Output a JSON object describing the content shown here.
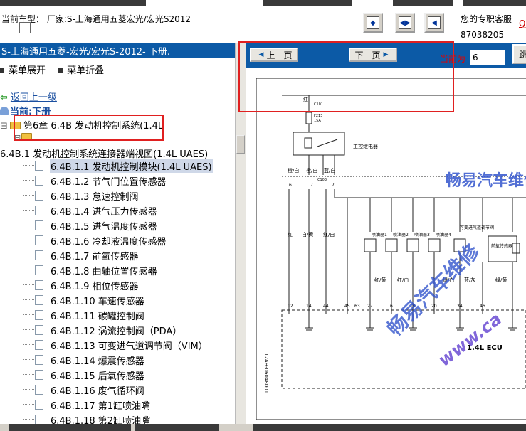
{
  "header": {
    "vehicle_label": "当前车型： 厂家:S-上海通用五菱宏光/宏光S2012",
    "service_label": "您的专职客服",
    "service_phone": "87038205",
    "service_link": "Q"
  },
  "left_panel": {
    "book_title": "S-上海通用五菱-宏光/宏光S-2012- 下册.",
    "menu_expand": "菜单展开",
    "menu_collapse": "菜单折叠",
    "back_link": "返回上一级",
    "current": "当前:下册",
    "chapter": "第6章 6.4B 发动机控制系统(1.4L",
    "section": "6.4B.1 发动机控制系统连接器端视图(1.4L UAES)",
    "items": [
      {
        "label": "6.4B.1.1 发动机控制模块(1.4L UAES)",
        "selected": true
      },
      {
        "label": "6.4B.1.2 节气门位置传感器"
      },
      {
        "label": "6.4B.1.3 怠速控制阀"
      },
      {
        "label": "6.4B.1.4 进气压力传感器"
      },
      {
        "label": "6.4B.1.5 进气温度传感器"
      },
      {
        "label": "6.4B.1.6 冷却液温度传感器"
      },
      {
        "label": "6.4B.1.7 前氧传感器"
      },
      {
        "label": "6.4B.1.8 曲轴位置传感器"
      },
      {
        "label": "6.4B.1.9 相位传感器"
      },
      {
        "label": "6.4B.1.10 车速传感器"
      },
      {
        "label": "6.4B.1.11 碳罐控制阀"
      },
      {
        "label": "6.4B.1.12 涡流控制阀（PDA）"
      },
      {
        "label": "6.4B.1.13 可变进气道调节阀（VIM）"
      },
      {
        "label": "6.4B.1.14 爆震传感器"
      },
      {
        "label": "6.4B.1.15 后氧传感器"
      },
      {
        "label": "6.4B.1.16 废气循环阀"
      },
      {
        "label": "6.4B.1.17 第1缸喷油嘴"
      },
      {
        "label": "6.4B.1.18 第2缸喷油嘴"
      }
    ]
  },
  "viewer": {
    "prev_label": "上一页",
    "next_label": "下一页",
    "current_page_label": "当前为",
    "current_page_value": "6",
    "jump_label": "跳"
  },
  "diagram": {
    "fuse_label": "红",
    "c101": "C101",
    "f213": "F213",
    "f213_rating": "15A",
    "main_relay": "主控继电器",
    "wire_top_left": "橙/白",
    "wire_top_mid1": "橙/白",
    "wire_top_mid2": "蓝/白",
    "c103": "C103",
    "pins_top": [
      "6",
      "7",
      "7"
    ],
    "wire_mid": [
      "红",
      "白/黄",
      "红/白"
    ],
    "injector1": "喷油器1",
    "injector2": "喷油器2",
    "injector3": "喷油器3",
    "injector4": "喷油器4",
    "vim": "可变进气道调节阀",
    "front_o2": "前氧传感器",
    "wire_low": [
      "红/黄",
      "红/白",
      "绿/白",
      "蓝/灰",
      "绿/黄"
    ],
    "pins_bottom": [
      "12",
      "14",
      "44",
      "45",
      "63",
      "27",
      "6",
      "19",
      "20",
      "34",
      "46"
    ],
    "ecu_label": "1.4L ECU",
    "side_code": "12AH-06048001",
    "watermark_cn": "畅易汽车维修",
    "watermark_url": "www.ca"
  },
  "colors": {
    "title_bar": "#0c5aa6",
    "annotation_red": "#e02020",
    "current_page_red": "#e00000",
    "watermark_blue": "#3355cc"
  }
}
